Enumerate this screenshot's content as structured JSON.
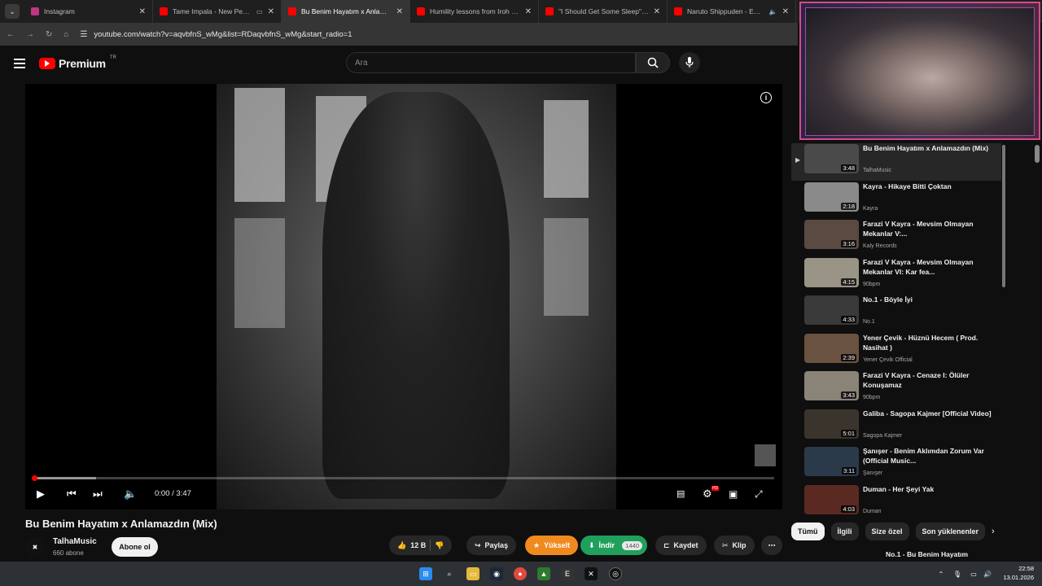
{
  "browser": {
    "tabs": [
      {
        "title": "Instagram",
        "color": "#c13584",
        "indicator": ""
      },
      {
        "title": "Tame Impala - New Person",
        "color": "#ff0000",
        "indicator": "▭"
      },
      {
        "title": "Bu Benim Hayatım x Anlamazdı",
        "color": "#ff0000",
        "indicator": ""
      },
      {
        "title": "Humility lessons from Iroh - Yo",
        "color": "#ff0000",
        "indicator": ""
      },
      {
        "title": "\"I Should Get Some Sleep\" Me",
        "color": "#ff0000",
        "indicator": ""
      },
      {
        "title": "Naruto Shippuden - Ending",
        "color": "#ff0000",
        "indicator": "🔈"
      }
    ],
    "active_tab": 2,
    "url": "youtube.com/watch?v=aqvbfnS_wMg&list=RDaqvbfnS_wMg&start_radio=1"
  },
  "youtube": {
    "logo": "Premium",
    "region": "TR",
    "search_placeholder": "Ara"
  },
  "player": {
    "time": "0:00 / 3:47",
    "progress_fraction": 0.0,
    "buffered_fraction": 0.085,
    "hd_badge": "HD"
  },
  "video": {
    "title": "Bu Benim Hayatım x Anlamazdın (Mix)",
    "channel": "TalhaMusic",
    "subscribers": "660 abone",
    "subscribe_label": "Abone ol",
    "likes": "12 B",
    "share_label": "Paylaş",
    "upgrade_label": "Yükselt",
    "download_label": "İndir",
    "download_quality": "1440",
    "save_label": "Kaydet",
    "clip_label": "Klip"
  },
  "playlist": [
    {
      "title": "Bu Benim Hayatım x Anlamazdın (Mix)",
      "channel": "TalhaMusic",
      "duration": "3:48",
      "current": true
    },
    {
      "title": "Kayra - Hikaye Bitti Çoktan",
      "channel": "Kayra",
      "duration": "2:18"
    },
    {
      "title": "Farazi V Kayra - Mevsim Olmayan Mekanlar V:...",
      "channel": "Kaly Records",
      "duration": "3:16"
    },
    {
      "title": "Farazi V Kayra - Mevsim Olmayan Mekanlar VI: Kar fea...",
      "channel": "90bpm",
      "duration": "4:15"
    },
    {
      "title": "No.1 - Böyle İyi",
      "channel": "No.1",
      "duration": "4:33"
    },
    {
      "title": "Yener Çevik - Hüznü Hecem ( Prod. Nasihat )",
      "channel": "Yener Çevik Official",
      "duration": "2:39"
    },
    {
      "title": "Farazi V Kayra - Cenaze I: Ölüler Konuşamaz",
      "channel": "90bpm",
      "duration": "3:43"
    },
    {
      "title": "Galiba - Sagopa Kajmer [Official Video]",
      "channel": "Sagopa Kajmer",
      "duration": "5:01"
    },
    {
      "title": "Şanışer - Benim Aklımdan Zorum Var (Official Music...",
      "channel": "Şanışer",
      "duration": "3:11"
    },
    {
      "title": "Duman - Her Şeyi Yak",
      "channel": "Duman",
      "duration": "4:03"
    }
  ],
  "chips": [
    "Tümü",
    "İlgili",
    "Size özel",
    "Son yüklenenler"
  ],
  "next_up": "No.1 - Bu Benim Hayatım",
  "taskbar": {
    "time": "22:58",
    "date": "13.01.2026"
  }
}
